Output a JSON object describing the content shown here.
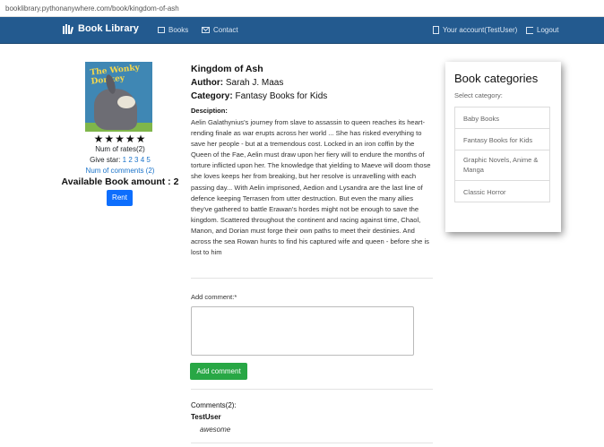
{
  "browser": {
    "url": "booklibrary.pythonanywhere.com/book/kingdom-of-ash"
  },
  "navbar": {
    "brand": "Book Library",
    "links": {
      "books": "Books",
      "contact": "Contact",
      "account": "Your account(TestUser)",
      "logout": "Logout"
    }
  },
  "book": {
    "cover_title": "The Wonky Donkey",
    "stars": "★★★★★",
    "num_rates": "Num of rates(2)",
    "give_star_label": "Give star:",
    "give_star_options": [
      "1",
      "2",
      "3",
      "4",
      "5"
    ],
    "num_comments": "Num of comments (2)",
    "available_amount": "Available Book amount : 2",
    "rent_label": "Rent",
    "title": "Kingdom of Ash",
    "author_label": "Author:",
    "author": "Sarah J. Maas",
    "category_label": "Category:",
    "category": "Fantasy Books for Kids",
    "description_label": "Desciption:",
    "description": "Aelin Galathynius's journey from slave to assassin to queen reaches its heart-rending finale as war erupts across her world ... She has risked everything to save her people - but at a tremendous cost. Locked in an iron coffin by the Queen of the Fae, Aelin must draw upon her fiery will to endure the months of torture inflicted upon her. The knowledge that yielding to Maeve will doom those she loves keeps her from breaking, but her resolve is unravelling with each passing day... With Aelin imprisoned, Aedion and Lysandra are the last line of defence keeping Terrasen from utter destruction. But even the many allies they've gathered to battle Erawan's hordes might not be enough to save the kingdom. Scattered throughout the continent and racing against time, Chaol, Manon, and Dorian must forge their own paths to meet their destinies. And across the sea Rowan hunts to find his captured wife and queen - before she is lost to him"
  },
  "comment_form": {
    "label": "Add comment:*",
    "value": "",
    "button_label": "Add comment"
  },
  "comments": {
    "heading": "Comments(2):",
    "items": [
      {
        "user": "TestUser",
        "text": "awesome"
      }
    ]
  },
  "categories": {
    "title": "Book categories",
    "subtitle": "Select category:",
    "items": [
      "Baby Books",
      "Fantasy Books for Kids",
      "Graphic Novels, Anime & Manga",
      "Classic Horror"
    ]
  },
  "colors": {
    "navbar": "#235a8f",
    "rent_button": "#0d6efd",
    "add_button": "#28a745",
    "link": "#1a73c9"
  }
}
